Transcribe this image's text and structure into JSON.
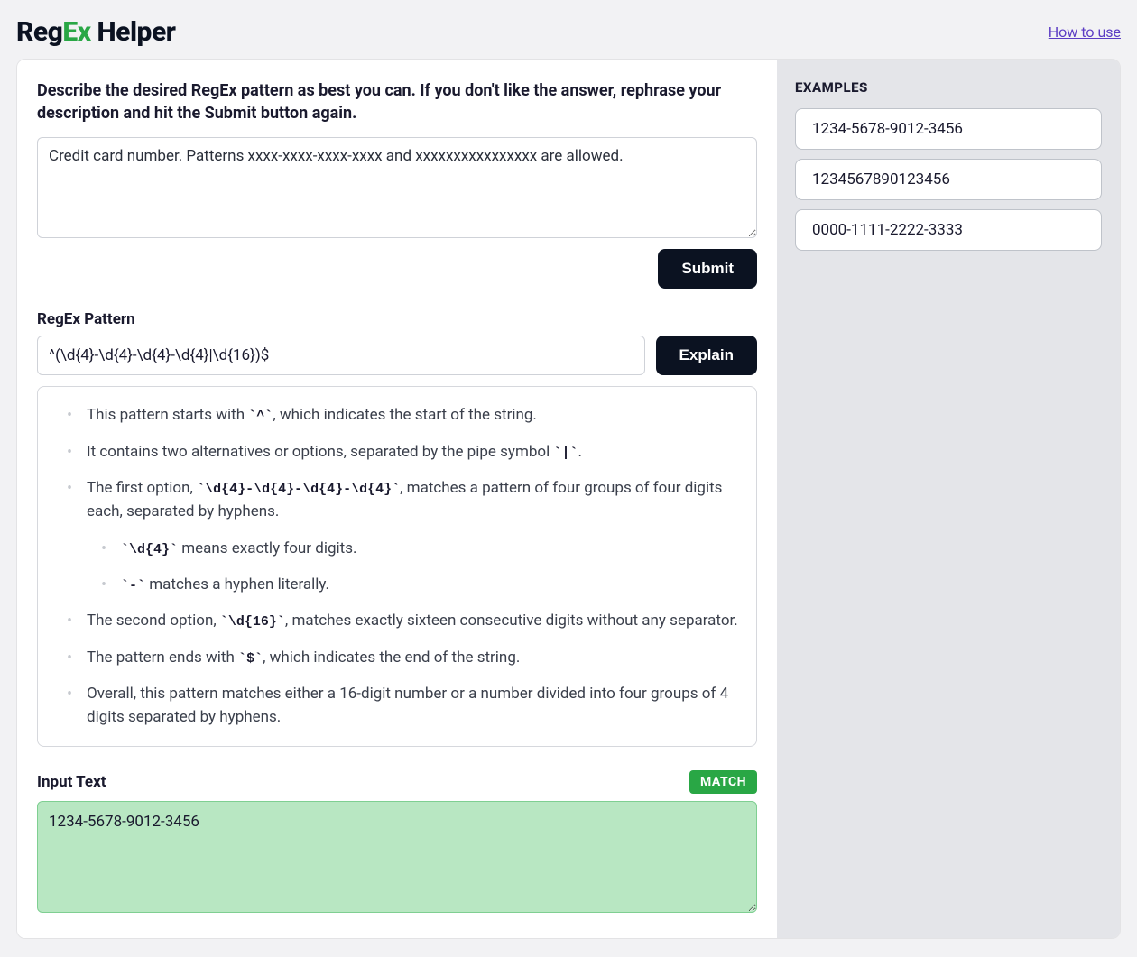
{
  "header": {
    "logo_pre": "Reg",
    "logo_accent": "Ex",
    "logo_post": " Helper",
    "how_link": "How to use"
  },
  "main": {
    "prompt_label": "Describe the desired RegEx pattern as best you can. If you don't like the answer, rephrase your description and hit the Submit button again.",
    "description_value": "Credit card number. Patterns xxxx-xxxx-xxxx-xxxx and xxxxxxxxxxxxxxxx are allowed.",
    "submit_label": "Submit",
    "regex_label": "RegEx Pattern",
    "regex_value": "^(\\d{4}-\\d{4}-\\d{4}-\\d{4}|\\d{16})$",
    "explain_label": "Explain",
    "explanation": {
      "i0_a": "This pattern starts with ",
      "i0_c": "`^`",
      "i0_b": ", which indicates the start of the string.",
      "i1_a": "It contains two alternatives or options, separated by the pipe symbol ",
      "i1_c": "`|`",
      "i1_b": ".",
      "i2_a": "The first option, ",
      "i2_c": "`\\d{4}-\\d{4}-\\d{4}-\\d{4}`",
      "i2_b": ", matches a pattern of four groups of four digits each, separated by hyphens.",
      "i2_s0_c": "`\\d{4}`",
      "i2_s0_b": " means exactly four digits.",
      "i2_s1_c": "`-`",
      "i2_s1_b": " matches a hyphen literally.",
      "i3_a": "The second option, ",
      "i3_c": "`\\d{16}`",
      "i3_b": ", matches exactly sixteen consecutive digits without any separator.",
      "i4_a": "The pattern ends with ",
      "i4_c": "`$`",
      "i4_b": ", which indicates the end of the string.",
      "i5": "Overall, this pattern matches either a 16-digit number or a number divided into four groups of 4 digits separated by hyphens."
    },
    "input_label": "Input Text",
    "match_badge": "MATCH",
    "input_value": "1234-5678-9012-3456"
  },
  "sidebar": {
    "examples_title": "EXAMPLES",
    "examples": [
      "1234-5678-9012-3456",
      "1234567890123456",
      "0000-1111-2222-3333"
    ]
  }
}
